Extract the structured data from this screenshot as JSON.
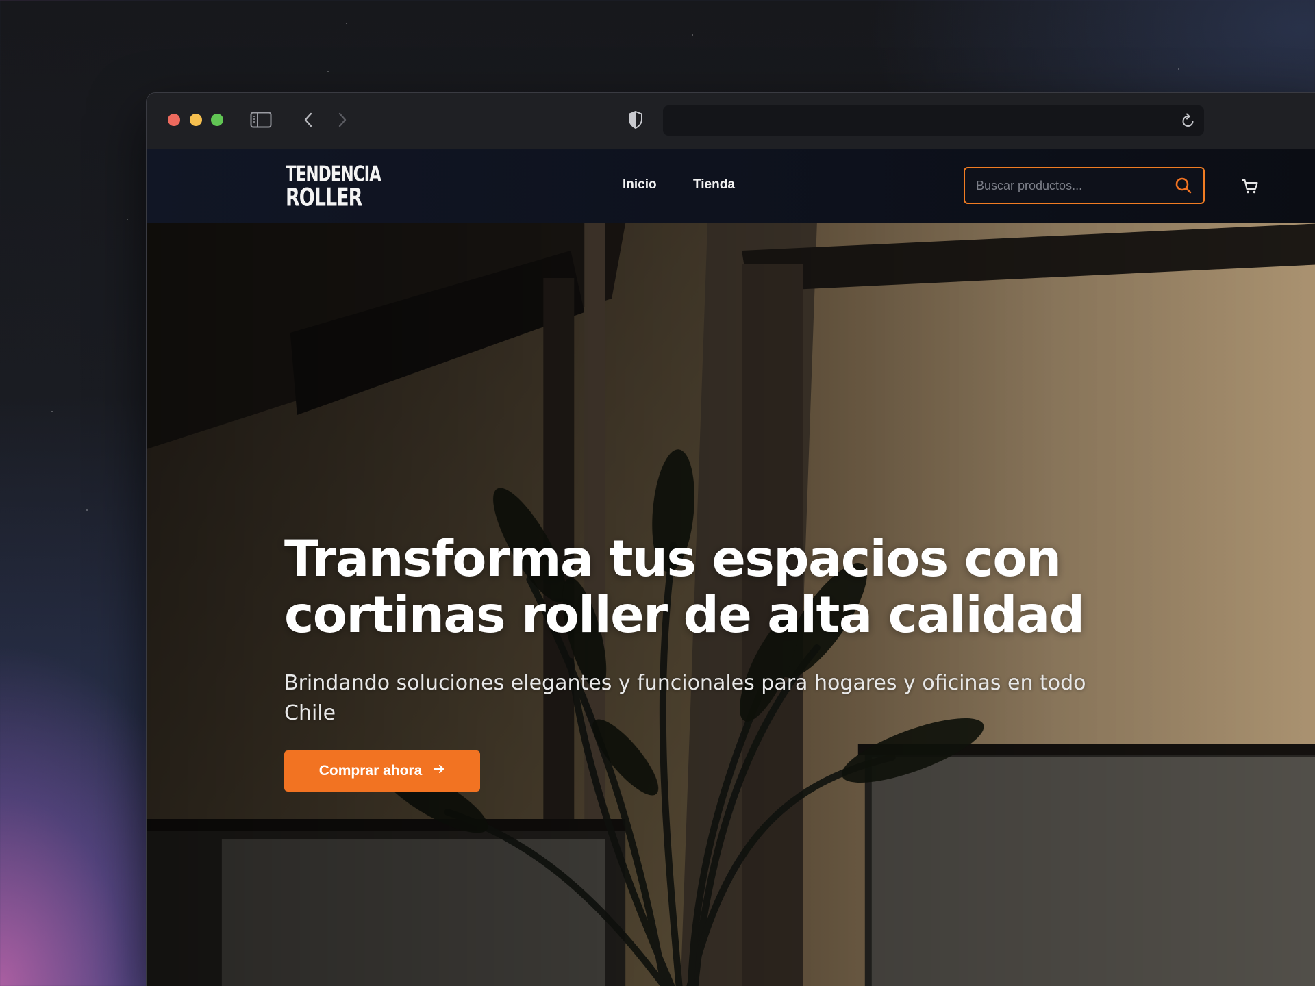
{
  "browser": {
    "address_bar_value": ""
  },
  "site": {
    "logo": {
      "line1": "TENDENCIA",
      "line2": "ROLLER"
    },
    "nav": [
      {
        "label": "Inicio"
      },
      {
        "label": "Tienda"
      }
    ],
    "search": {
      "placeholder": "Buscar productos..."
    },
    "icons": {
      "search": "search-icon",
      "cart": "cart-icon"
    }
  },
  "hero": {
    "title_line1": "Transforma tus espacios con",
    "title_line2": "cortinas roller de alta calidad",
    "subtitle": "Brindando soluciones elegantes y funcionales para hogares y oficinas en todo Chile",
    "cta_label": "Comprar ahora"
  },
  "colors": {
    "accent": "#f27322",
    "navbar": "#0d111c",
    "text": "#ffffff"
  }
}
